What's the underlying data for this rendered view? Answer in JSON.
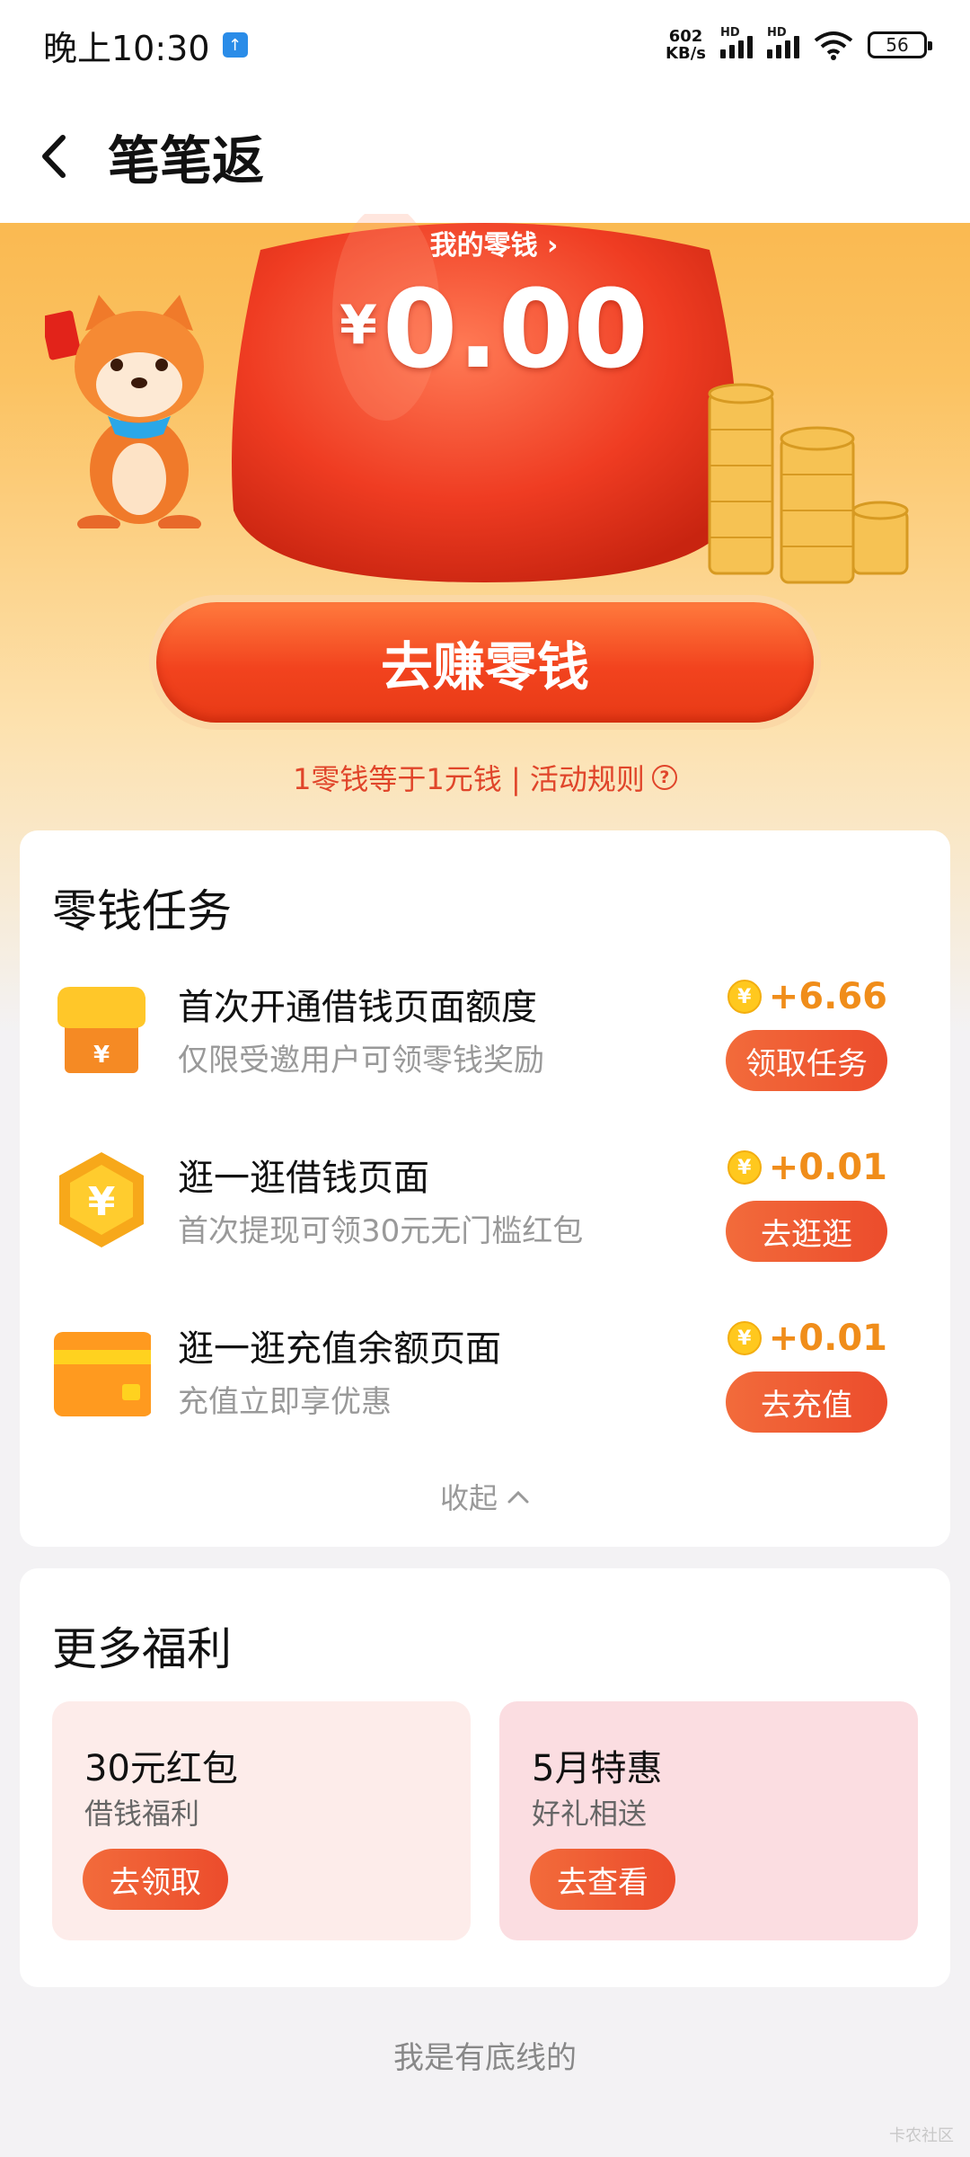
{
  "status_bar": {
    "time": "晚上10:30",
    "net_speed_value": "602",
    "net_speed_unit": "KB/s",
    "signal_1_label": "HD",
    "signal_2_label": "HD",
    "battery": "56"
  },
  "nav": {
    "title": "笔笔返"
  },
  "hero": {
    "balance_label": "我的零钱 ›",
    "currency": "¥",
    "balance": "0.00",
    "earn_button": "去赚零钱",
    "rule_text": "1零钱等于1元钱 | 活动规则",
    "help_icon_glyph": "?"
  },
  "tasks": {
    "title": "零钱任务",
    "coin_glyph": "¥",
    "items": [
      {
        "title": "首次开通借钱页面额度",
        "subtitle": "仅限受邀用户可领零钱奖励",
        "reward": "+6.66",
        "button": "领取任务",
        "icon": "shop-icon"
      },
      {
        "title": "逛一逛借钱页面",
        "subtitle": "首次提现可领30元无门槛红包",
        "reward": "+0.01",
        "button": "去逛逛",
        "icon": "yen-coin-icon"
      },
      {
        "title": "逛一逛充值余额页面",
        "subtitle": "充值立即享优惠",
        "reward": "+0.01",
        "button": "去充值",
        "icon": "card-icon"
      }
    ],
    "collapse_label": "收起"
  },
  "more": {
    "title": "更多福利",
    "items": [
      {
        "title": "30元红包",
        "subtitle": "借钱福利",
        "button": "去领取"
      },
      {
        "title": "5月特惠",
        "subtitle": "好礼相送",
        "button": "去查看"
      }
    ]
  },
  "footer": {
    "text": "我是有底线的",
    "watermark": "卡农社区"
  },
  "colors": {
    "accent": "#ec4c2c",
    "reward": "#f08d1a",
    "hero_top": "#f8ad3a"
  }
}
